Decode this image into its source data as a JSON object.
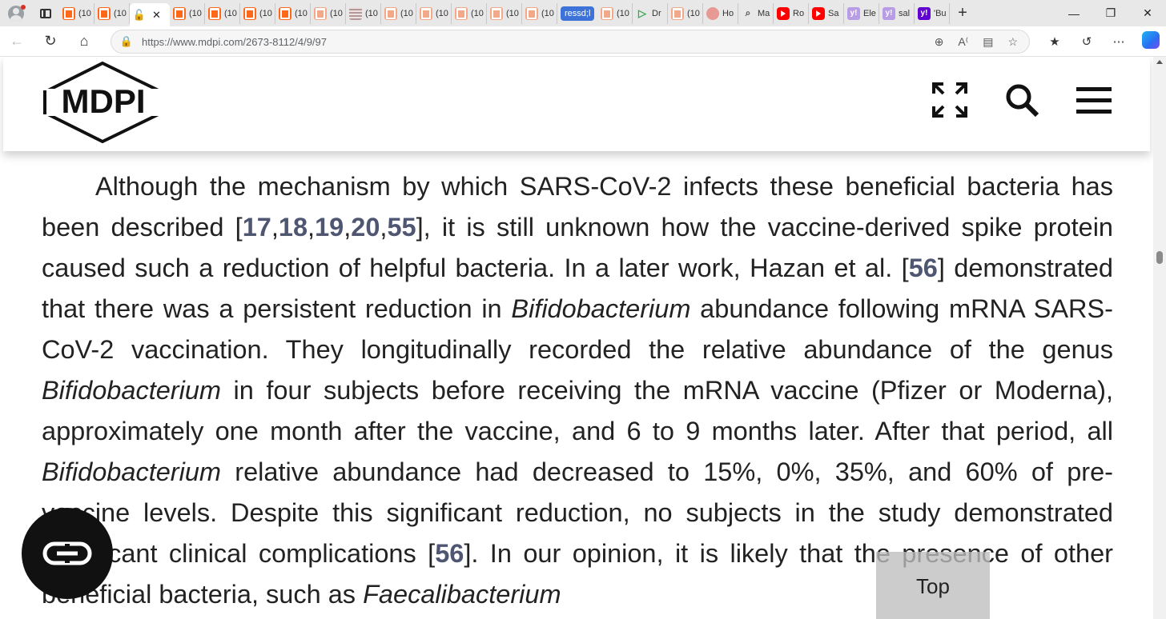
{
  "browser": {
    "tabs": [
      {
        "icon": "substack-icon",
        "label": "(10"
      },
      {
        "icon": "substack-icon",
        "label": "(10"
      },
      {
        "icon": "mdpi-lock-icon",
        "label": "",
        "active": true
      },
      {
        "icon": "substack-icon",
        "label": "(10"
      },
      {
        "icon": "substack-icon",
        "label": "(10"
      },
      {
        "icon": "substack-icon",
        "label": "(10"
      },
      {
        "icon": "substack-icon",
        "label": "(10"
      },
      {
        "icon": "substack-icon",
        "label": "(10"
      },
      {
        "icon": "grid-icon",
        "label": "(10"
      },
      {
        "icon": "substack-icon",
        "label": "(10"
      },
      {
        "icon": "substack-icon",
        "label": "(10"
      },
      {
        "icon": "substack-icon",
        "label": "(10"
      },
      {
        "icon": "substack-icon",
        "label": "(10"
      },
      {
        "icon": "substack-icon",
        "label": "(10"
      },
      {
        "icon": "pill",
        "label": "ressd;l"
      },
      {
        "icon": "substack-icon",
        "label": "(10"
      },
      {
        "icon": "play-icon",
        "label": "Dr"
      },
      {
        "icon": "substack-icon",
        "label": "(10"
      },
      {
        "icon": "avatar-icon",
        "label": "Ho"
      },
      {
        "icon": "search-icon",
        "label": "Ma"
      },
      {
        "icon": "youtube-icon",
        "label": "Ro"
      },
      {
        "icon": "youtube-icon",
        "label": "Sa"
      },
      {
        "icon": "yahoo-icon",
        "label": "Ele"
      },
      {
        "icon": "yahoo-icon",
        "label": "sal"
      },
      {
        "icon": "yahoo-icon",
        "label": "'Bu"
      }
    ],
    "new_tab": "+",
    "window_controls": {
      "minimize": "—",
      "restore": "❐",
      "close": "✕"
    },
    "url": "https://www.mdpi.com/2673-8112/4/9/97"
  },
  "site": {
    "logo_text": "MDPI",
    "icons": [
      "expand-icon",
      "search-icon",
      "menu-icon"
    ]
  },
  "article": {
    "p1": "Although the mechanism by which SARS-CoV-2 infects these beneficial bacteria has been described [",
    "refs1": [
      "17",
      "18",
      "19",
      "20",
      "55"
    ],
    "p2": "], it is still unknown how the vaccine-derived spike protein caused such a reduction of helpful bacteria. In a later work, Hazan et al. [",
    "ref2": "56",
    "p3": "] demonstrated that there was a persistent reduction in ",
    "genus1": "Bifidobacterium",
    "p4": " abundance following mRNA SARS-CoV-2 vaccination. They longitudinally recorded the relative abundance of the genus ",
    "genus2": "Bifidobacterium",
    "p5": " in four subjects before receiving the mRNA vaccine (Pfizer or Moderna), approximately one month after the vaccine, and 6 to 9 months later. After that period, all ",
    "genus3": "Bifidobacterium",
    "p6": " relative abundance had decreased to 15%, 0%, 35%, and 60% of pre-vaccine levels. Despite this significant reduction, no subjects in the study demonstrated significant clinical complications [",
    "ref3": "56",
    "p7": "]. In our opinion, it is likely that the presence of other beneficial bacteria, such as ",
    "genus4": "Faecalibacterium"
  },
  "overlay": {
    "top_label": "Top"
  }
}
